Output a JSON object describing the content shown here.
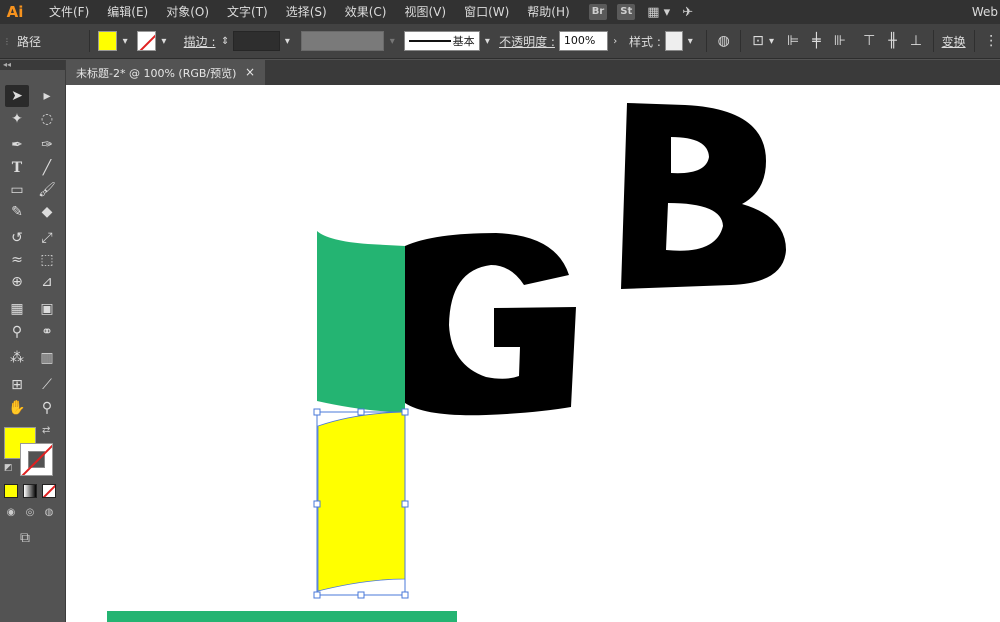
{
  "app": {
    "logo": "Ai",
    "workspace": "Web"
  },
  "menu": [
    "文件(F)",
    "编辑(E)",
    "对象(O)",
    "文字(T)",
    "选择(S)",
    "效果(C)",
    "视图(V)",
    "窗口(W)",
    "帮助(H)"
  ],
  "menu_extras": {
    "bridge": "Br",
    "stock": "St"
  },
  "control": {
    "selection_label": "路径",
    "stroke_label": "描边 :",
    "stroke_profile": "基本",
    "opacity_label": "不透明度 :",
    "opacity_value": "100%",
    "style_label": "样式 :",
    "transform_label": "变换"
  },
  "document": {
    "tab_title": "未标题-2* @ 100% (RGB/预览)",
    "close": "×"
  },
  "colors": {
    "fill": "#ffff00",
    "green": "#24b472",
    "black": "#000000",
    "selection": "#4a78d8"
  },
  "artwork": {
    "letter_g": "G",
    "letter_b": "B"
  }
}
